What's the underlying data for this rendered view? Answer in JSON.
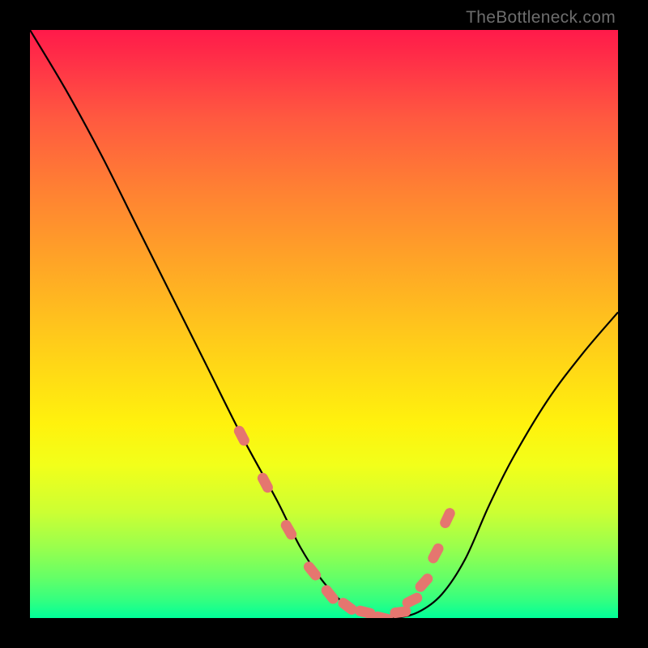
{
  "watermark": "TheBottleneck.com",
  "chart_data": {
    "type": "line",
    "title": "",
    "xlabel": "",
    "ylabel": "",
    "xlim": [
      0,
      100
    ],
    "ylim": [
      0,
      100
    ],
    "series": [
      {
        "name": "curve",
        "x": [
          0,
          6,
          12,
          18,
          24,
          30,
          36,
          42,
          46,
          50,
          54,
          58,
          62,
          66,
          70,
          74,
          78,
          82,
          88,
          94,
          100
        ],
        "values": [
          100,
          90,
          79,
          67,
          55,
          43,
          31,
          20,
          12,
          6,
          2,
          0,
          0,
          1,
          4,
          10,
          19,
          27,
          37,
          45,
          52
        ]
      }
    ],
    "markers": {
      "name": "highlight-dots",
      "color": "#e5766f",
      "x": [
        36,
        40,
        44,
        48,
        51,
        54,
        57,
        60,
        63,
        65,
        67,
        69,
        71
      ],
      "values": [
        31,
        23,
        15,
        8,
        4,
        2,
        1,
        0,
        1,
        3,
        6,
        11,
        17
      ]
    },
    "background_gradient": {
      "top": "#ff1a4a",
      "bottom": "#00ff99"
    }
  }
}
